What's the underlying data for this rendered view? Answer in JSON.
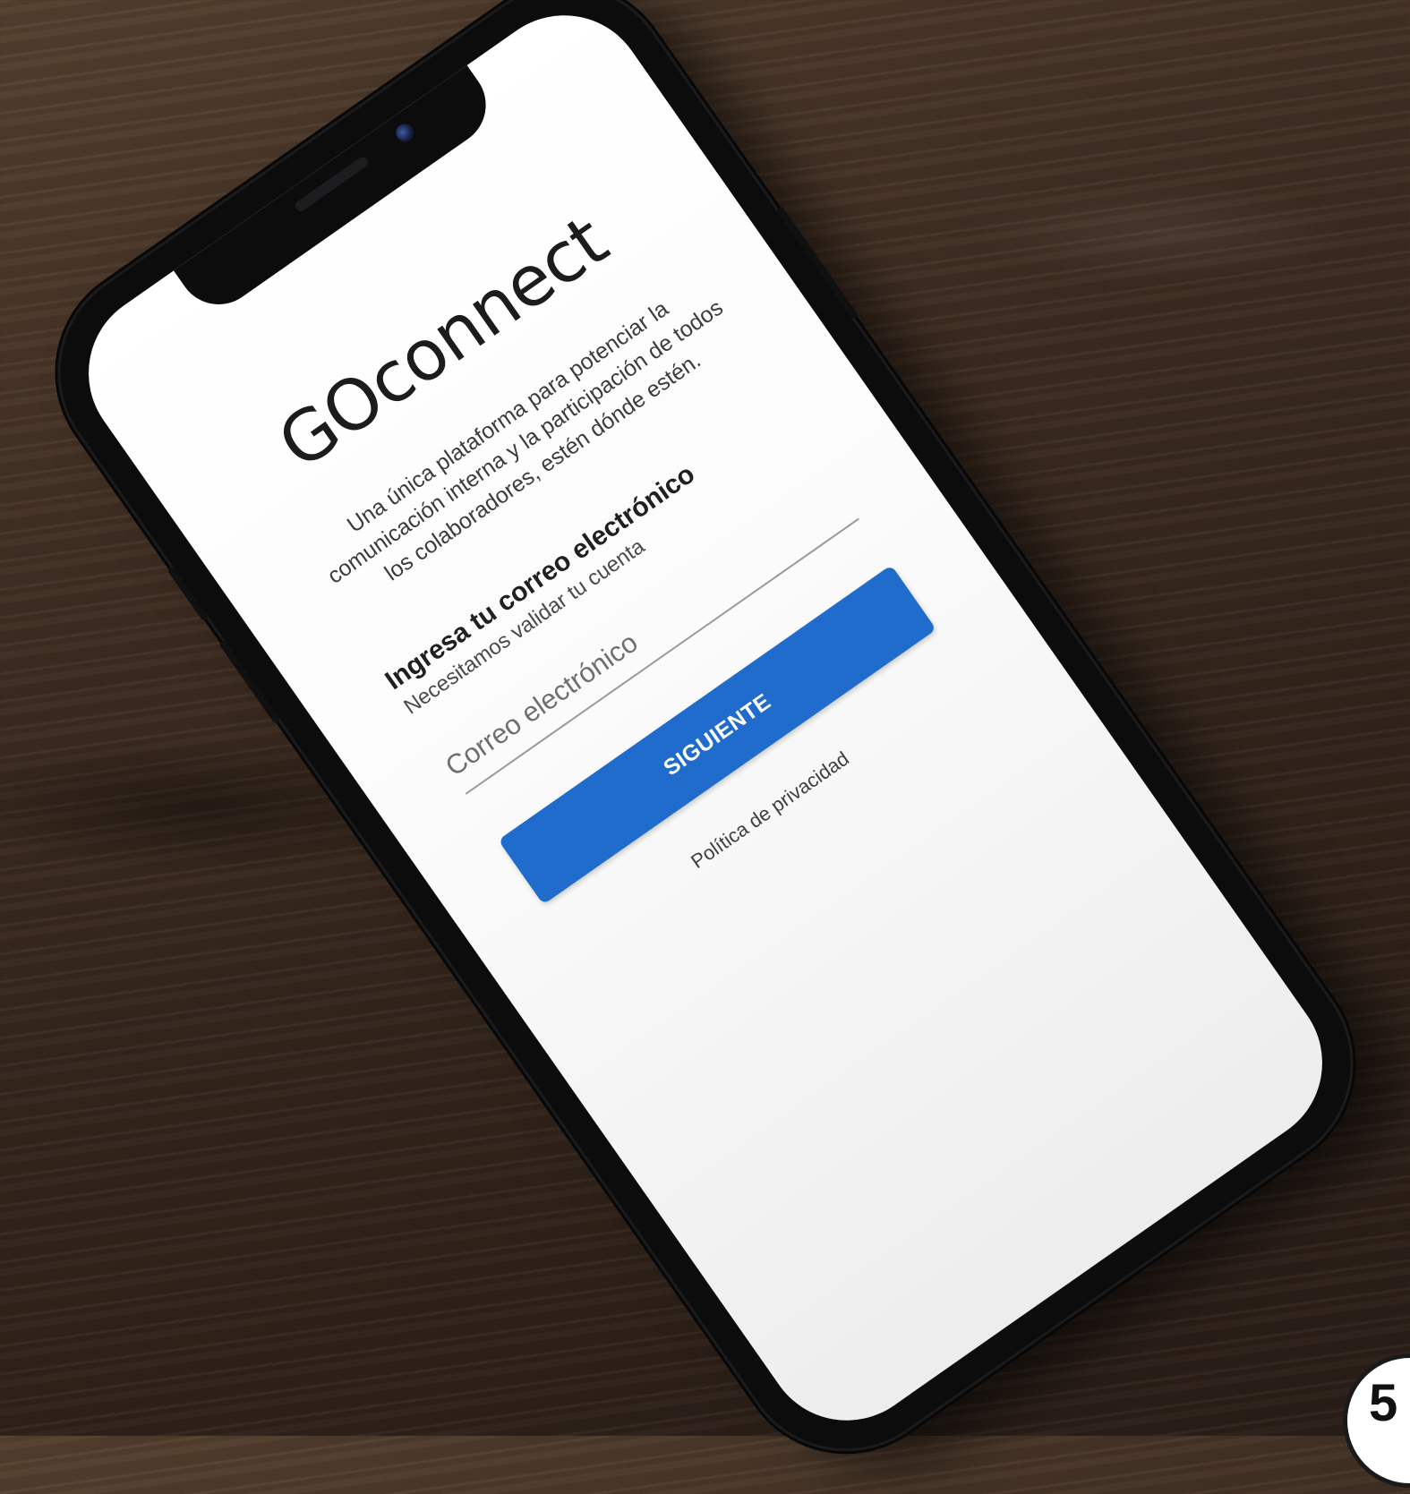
{
  "app": {
    "brand": "GOconnect",
    "tagline": "Una única plataforma para potenciar la comunicación interna y la participación de todos los colaboradores, estén dónde estén."
  },
  "login": {
    "title": "Ingresa tu correo electrónico",
    "subtitle": "Necesitamos validar tu cuenta",
    "email_placeholder": "Correo electrónico",
    "email_value": "",
    "next_label": "SIGUIENTE",
    "privacy_label": "Política de privacidad"
  },
  "page_badge": "5",
  "colors": {
    "accent": "#1f6ccc",
    "screen_bg": "#ffffff",
    "phone_body": "#0c0c0d",
    "table_wood": "#3d2c21"
  },
  "icons": {
    "camera": "front-camera-icon"
  }
}
